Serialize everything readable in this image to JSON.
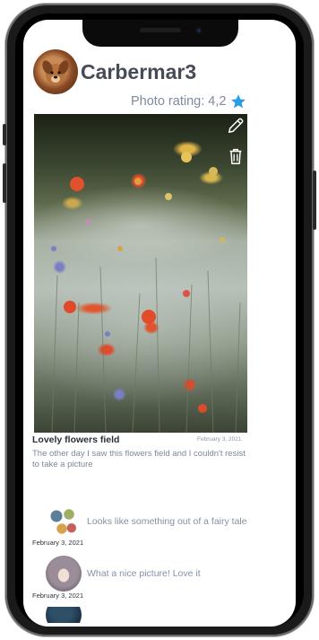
{
  "profile": {
    "username": "Carbermar3",
    "rating_label": "Photo rating: 4,2",
    "rating_icon": "star-icon",
    "accent_color": "#2c9be6"
  },
  "post": {
    "title": "Lovely flowers field",
    "date": "February 3, 2021",
    "description": "The other day I  saw this flowers field and I couldn't resist to take a picture",
    "actions": {
      "edit_icon": "pencil-icon",
      "delete_icon": "trash-icon"
    }
  },
  "comments": [
    {
      "text": "Looks like something out of a fairy tale",
      "date": "February 3, 2021"
    },
    {
      "text": "What a nice picture! Love it",
      "date": "February 3, 2021"
    }
  ]
}
